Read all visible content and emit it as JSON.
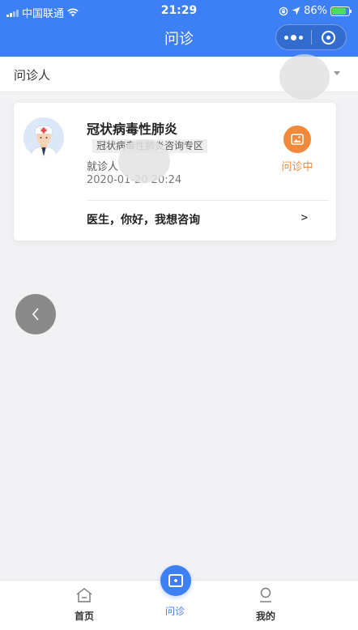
{
  "status_bar": {
    "carrier": "中国联通",
    "time": "21:29",
    "battery": "86%",
    "icons": [
      "signal-icon",
      "wifi-icon",
      "lock-rotation-icon",
      "location-icon",
      "battery-charging-icon"
    ]
  },
  "nav": {
    "title": "问诊",
    "more_icon": "more-icon",
    "close_icon": "close-icon"
  },
  "patient": {
    "label": "问诊人",
    "arrow_icon": "triangle-down-icon"
  },
  "consultation": {
    "title": "冠状病毒性肺炎",
    "tag": "冠状病毒性肺炎咨询专区",
    "visitor_label": "就诊人",
    "time": "2020-01-20 20:24",
    "status_label": "问诊中",
    "status_color": "#f0893a",
    "message": "医生，你好，我想咨询",
    "chevron": ">"
  },
  "tabbar": {
    "home": "首页",
    "consult": "问诊",
    "mine": "我的",
    "active_color": "#3d7ff5"
  },
  "colors": {
    "brand": "#3d7ff5",
    "background": "#f2f2f4"
  }
}
